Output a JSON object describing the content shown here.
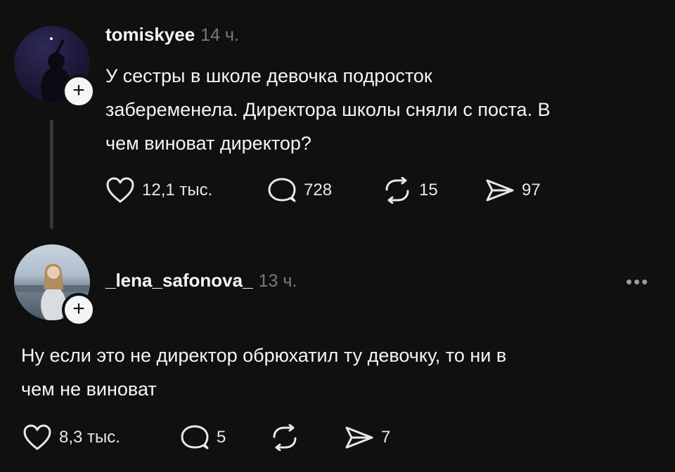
{
  "posts": [
    {
      "username": "tomiskyee",
      "time": "14 ч.",
      "text_lines": [
        "У сестры в школе девочка подросток",
        "забеременела. Директора школы сняли с поста. В",
        "чем виноват директор?"
      ],
      "likes": "12,1 тыс.",
      "comments": "728",
      "reposts": "15",
      "shares": "97"
    },
    {
      "username": "_lena_safonova_",
      "time": "13 ч.",
      "text_lines": [
        "Ну если это не директор обрюхатил ту девочку, то ни в",
        "чем не виноват"
      ],
      "likes": "8,3 тыс.",
      "comments": "5",
      "reposts": "",
      "shares": "7"
    }
  ],
  "more_label": "•••",
  "icons": {
    "plus": "+",
    "like": "heart-icon",
    "comment": "comment-icon",
    "repost": "repost-icon",
    "share": "share-icon"
  }
}
